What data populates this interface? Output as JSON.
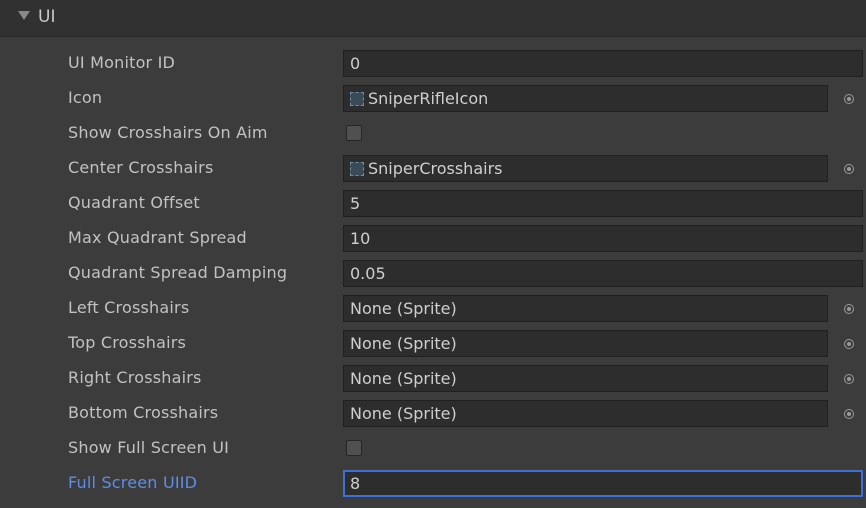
{
  "header": {
    "title": "UI"
  },
  "fields": {
    "ui_monitor_id": {
      "label": "UI Monitor ID",
      "value": "0"
    },
    "icon": {
      "label": "Icon",
      "value": "SniperRifleIcon"
    },
    "show_crosshairs_on_aim": {
      "label": "Show Crosshairs On Aim",
      "checked": false
    },
    "center_crosshairs": {
      "label": "Center Crosshairs",
      "value": "SniperCrosshairs"
    },
    "quadrant_offset": {
      "label": "Quadrant Offset",
      "value": "5"
    },
    "max_quadrant_spread": {
      "label": "Max Quadrant Spread",
      "value": "10"
    },
    "quadrant_spread_damping": {
      "label": "Quadrant Spread Damping",
      "value": "0.05"
    },
    "left_crosshairs": {
      "label": "Left Crosshairs",
      "value": "None (Sprite)"
    },
    "top_crosshairs": {
      "label": "Top Crosshairs",
      "value": "None (Sprite)"
    },
    "right_crosshairs": {
      "label": "Right Crosshairs",
      "value": "None (Sprite)"
    },
    "bottom_crosshairs": {
      "label": "Bottom Crosshairs",
      "value": "None (Sprite)"
    },
    "show_full_screen_ui": {
      "label": "Show Full Screen UI",
      "checked": false
    },
    "full_screen_uiid": {
      "label": "Full Screen UIID",
      "value": "8"
    }
  },
  "colors": {
    "background": "#3c3c3c",
    "field_background": "#2d2d2d",
    "focused_label": "#5c8ee8",
    "focused_border": "#3d6fd8"
  }
}
